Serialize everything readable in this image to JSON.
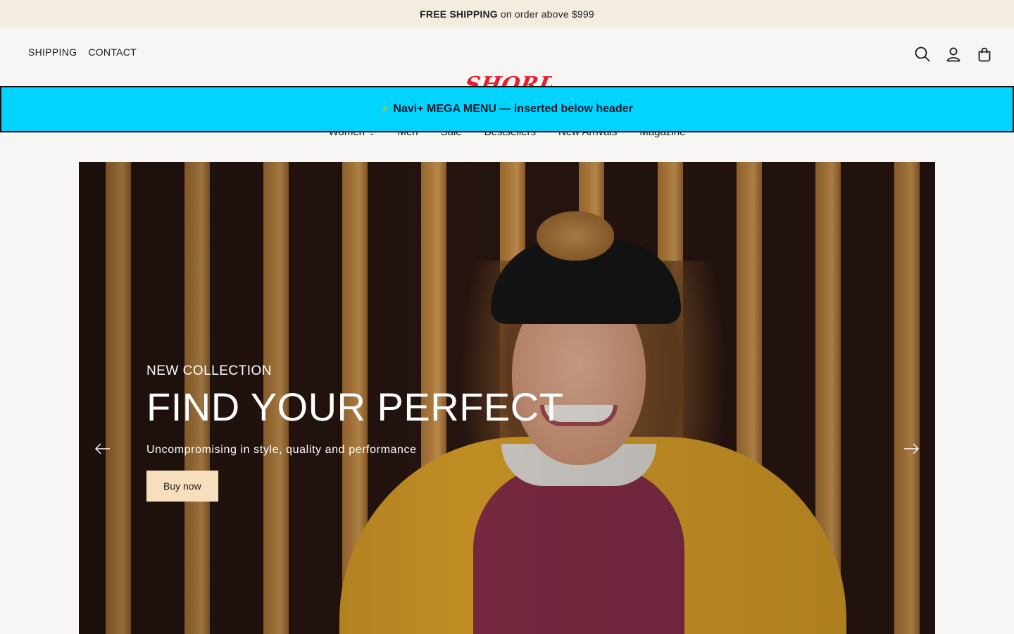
{
  "announcement": {
    "bold": "FREE SHIPPING",
    "text": "on order above $999"
  },
  "header": {
    "links": [
      "SHIPPING",
      "CONTACT"
    ],
    "logo_text": "SHORD",
    "icons": [
      "search-icon",
      "account-icon",
      "cart-icon"
    ]
  },
  "nav": {
    "items": [
      "Women",
      "Men",
      "Sale",
      "Bestsellers",
      "New Arrivals",
      "Magazine"
    ],
    "women_caret": "⌄"
  },
  "mega_menu": {
    "icon": "⚡",
    "text": "Navi+ MEGA MENU — inserted below header",
    "color": "#00d4ff"
  },
  "hero": {
    "kicker": "NEW COLLECTION",
    "headline": "FIND YOUR PERFECT",
    "subtext": "Uncompromising in style, quality and performance",
    "cta": "Buy now",
    "cta_color": "#f7dfbe"
  }
}
